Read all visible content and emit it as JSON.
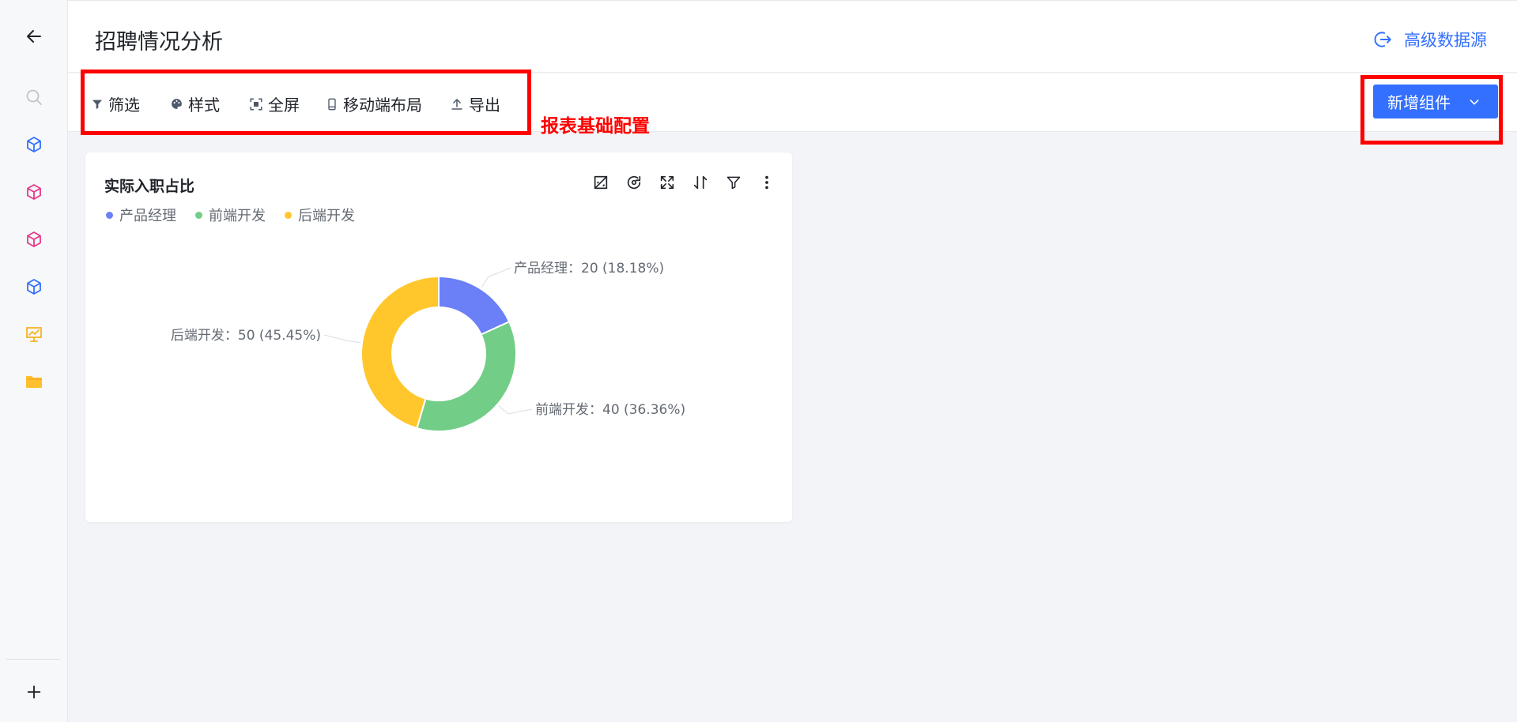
{
  "header": {
    "title": "招聘情况分析",
    "advanced_label": "高级数据源"
  },
  "toolbar": {
    "items": [
      {
        "label": "筛选",
        "icon": "filter-icon"
      },
      {
        "label": "样式",
        "icon": "palette-icon"
      },
      {
        "label": "全屏",
        "icon": "fullscreen-icon"
      },
      {
        "label": "移动端布局",
        "icon": "mobile-icon"
      },
      {
        "label": "导出",
        "icon": "export-icon"
      }
    ],
    "add_component_label": "新增组件"
  },
  "annotation": {
    "text": "报表基础配置"
  },
  "colors": {
    "accent": "#3370ff",
    "annotation": "#ff0000"
  },
  "card": {
    "title": "实际入职占比"
  },
  "chart_data": {
    "type": "pie",
    "donut": true,
    "title": "实际入职占比",
    "legend_placement": "top-left",
    "series": [
      {
        "name": "产品经理",
        "value": 20,
        "percent": "18.18%",
        "color": "#6b7ff7"
      },
      {
        "name": "前端开发",
        "value": 40,
        "percent": "36.36%",
        "color": "#72cd86"
      },
      {
        "name": "后端开发",
        "value": 50,
        "percent": "45.45%",
        "color": "#ffc72c"
      }
    ],
    "labels": [
      "产品经理：20 (18.18%)",
      "前端开发：40 (36.36%)",
      "后端开发：50 (45.45%)"
    ]
  }
}
